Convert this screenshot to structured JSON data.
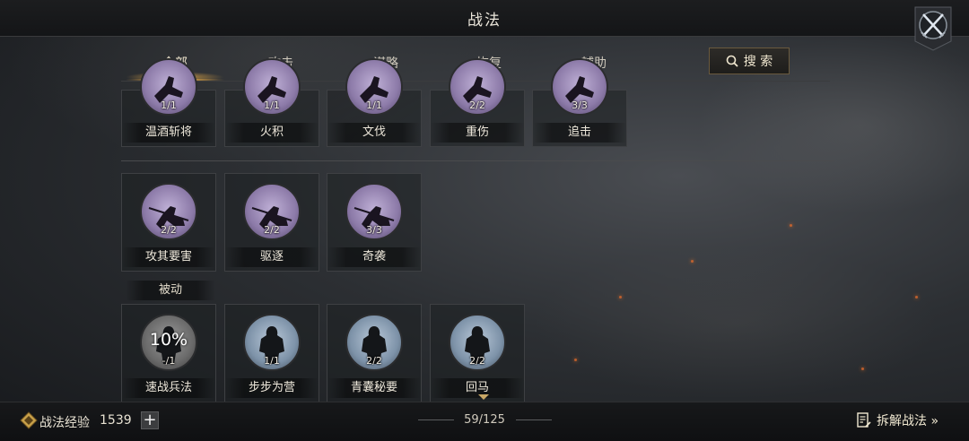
{
  "header": {
    "title": "战法"
  },
  "tabs": [
    {
      "label": "全部",
      "active": true
    },
    {
      "label": "攻击",
      "active": false
    },
    {
      "label": "谋略",
      "active": false
    },
    {
      "label": "恢复",
      "active": false
    },
    {
      "label": "辅助",
      "active": false
    }
  ],
  "search": {
    "label": "搜 索"
  },
  "row1": [
    {
      "name": "温酒斩将",
      "count": "1/1"
    },
    {
      "name": "火积",
      "count": "1/1"
    },
    {
      "name": "文伐",
      "count": "1/1"
    },
    {
      "name": "重伤",
      "count": "2/2"
    },
    {
      "name": "追击",
      "count": "3/3"
    }
  ],
  "row2": [
    {
      "name": "攻其要害",
      "count": "2/2"
    },
    {
      "name": "驱逐",
      "count": "2/2"
    },
    {
      "name": "奇袭",
      "count": "3/3"
    }
  ],
  "passive_section": {
    "label": "被动"
  },
  "row3": [
    {
      "name": "速战兵法",
      "count": "-/1",
      "progress": "10%"
    },
    {
      "name": "步步为营",
      "count": "1/1"
    },
    {
      "name": "青囊秘要",
      "count": "2/2"
    },
    {
      "name": "回马",
      "count": "2/2"
    }
  ],
  "footer": {
    "exp_label": "战法经验",
    "exp_value": "1539",
    "plus_label": "+",
    "page": "59/125",
    "decompose_label": "拆解战法 »"
  },
  "colors": {
    "accent_gold": "#e6a846",
    "purple_icon": "#8c7aa8",
    "blue_icon": "#7d92a8"
  }
}
